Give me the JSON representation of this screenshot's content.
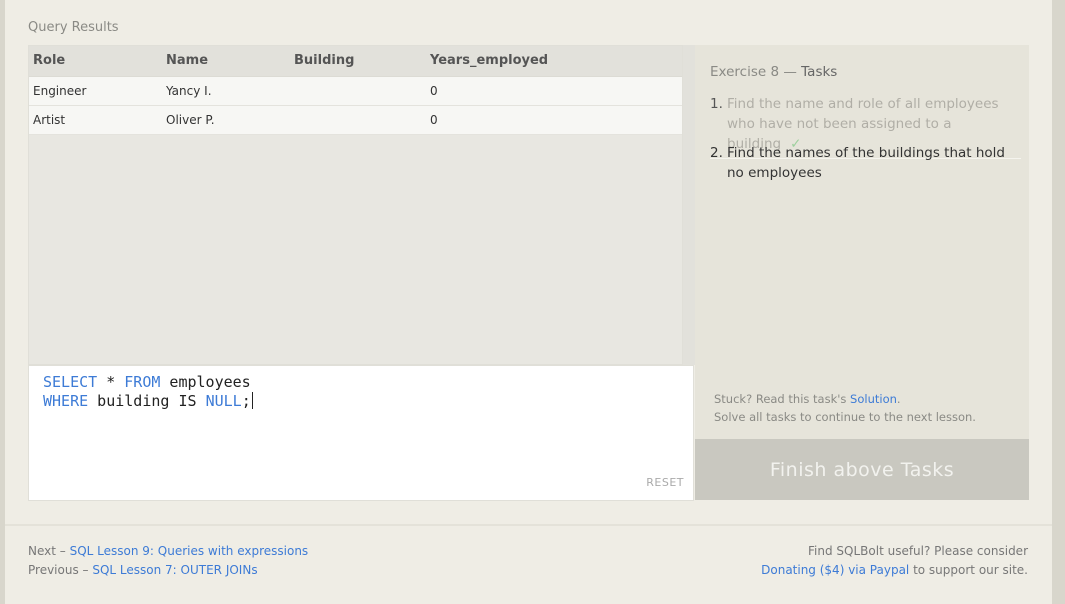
{
  "results": {
    "title": "Query Results",
    "columns": [
      "Role",
      "Name",
      "Building",
      "Years_employed"
    ],
    "rows": [
      [
        "Engineer",
        "Yancy I.",
        "",
        "0"
      ],
      [
        "Artist",
        "Oliver P.",
        "",
        "0"
      ]
    ]
  },
  "editor": {
    "line1": {
      "kw1": "SELECT",
      "mid": " * ",
      "kw2": "FROM",
      "rest": " employees"
    },
    "line2": {
      "kw1": "WHERE",
      "mid": " building IS ",
      "kw2": "NULL",
      "rest": ";"
    },
    "reset_label": "RESET"
  },
  "tasks": {
    "exercise": "Exercise 8",
    "dash": " — ",
    "label": "Tasks",
    "items": [
      {
        "num": "1.",
        "text": "Find the name and role of all employees who have not been assigned to a building",
        "done_mark": "✓"
      },
      {
        "num": "2.",
        "text": "Find the names of the buildings that hold no employees"
      }
    ],
    "stuck_prefix": "Stuck? Read this task's ",
    "solution_link": "Solution",
    "stuck_suffix": ".",
    "continue_text": "Solve all tasks to continue to the next lesson.",
    "finish_label": "Finish above Tasks"
  },
  "footer": {
    "next_prefix": "Next – ",
    "next_link": "SQL Lesson 9: Queries with expressions",
    "prev_prefix": "Previous – ",
    "prev_link": "SQL Lesson 7: OUTER JOINs",
    "useful_text": "Find SQLBolt useful? Please consider",
    "donate_link": "Donating ($4) via Paypal",
    "support_text": " to support our site."
  },
  "colors": {
    "accent": "#3d7bd6",
    "check": "#9ed09e",
    "finish_bg": "#c9c8c0"
  }
}
